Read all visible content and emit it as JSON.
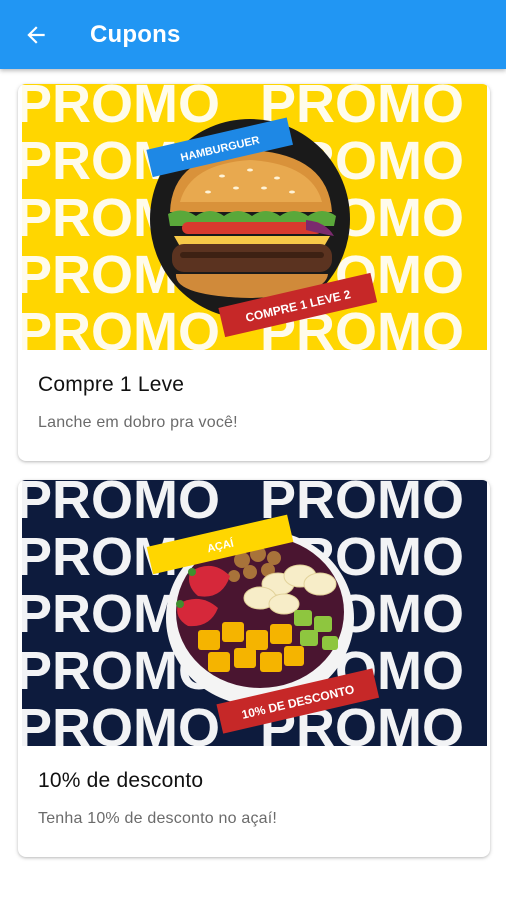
{
  "appbar": {
    "title": "Cupons",
    "back_icon": "arrow-left-icon",
    "color": "#2196f3"
  },
  "promo_word": "PROMO",
  "coupons": [
    {
      "tag": "HAMBURGUER",
      "badge": "COMPRE 1 LEVE 2",
      "title": "Compre 1 Leve",
      "subtitle": "Lanche em dobro pra você!",
      "banner_bg": "#ffd600",
      "tag_color": "#1e88e5",
      "badge_color": "#c62828"
    },
    {
      "tag": "AÇAÍ",
      "badge": "10% DE DESCONTO",
      "title": "10% de desconto",
      "subtitle": "Tenha 10% de desconto no açaí!",
      "banner_bg": "#0d1b3d",
      "tag_color": "#ffd600",
      "badge_color": "#c62828"
    }
  ]
}
